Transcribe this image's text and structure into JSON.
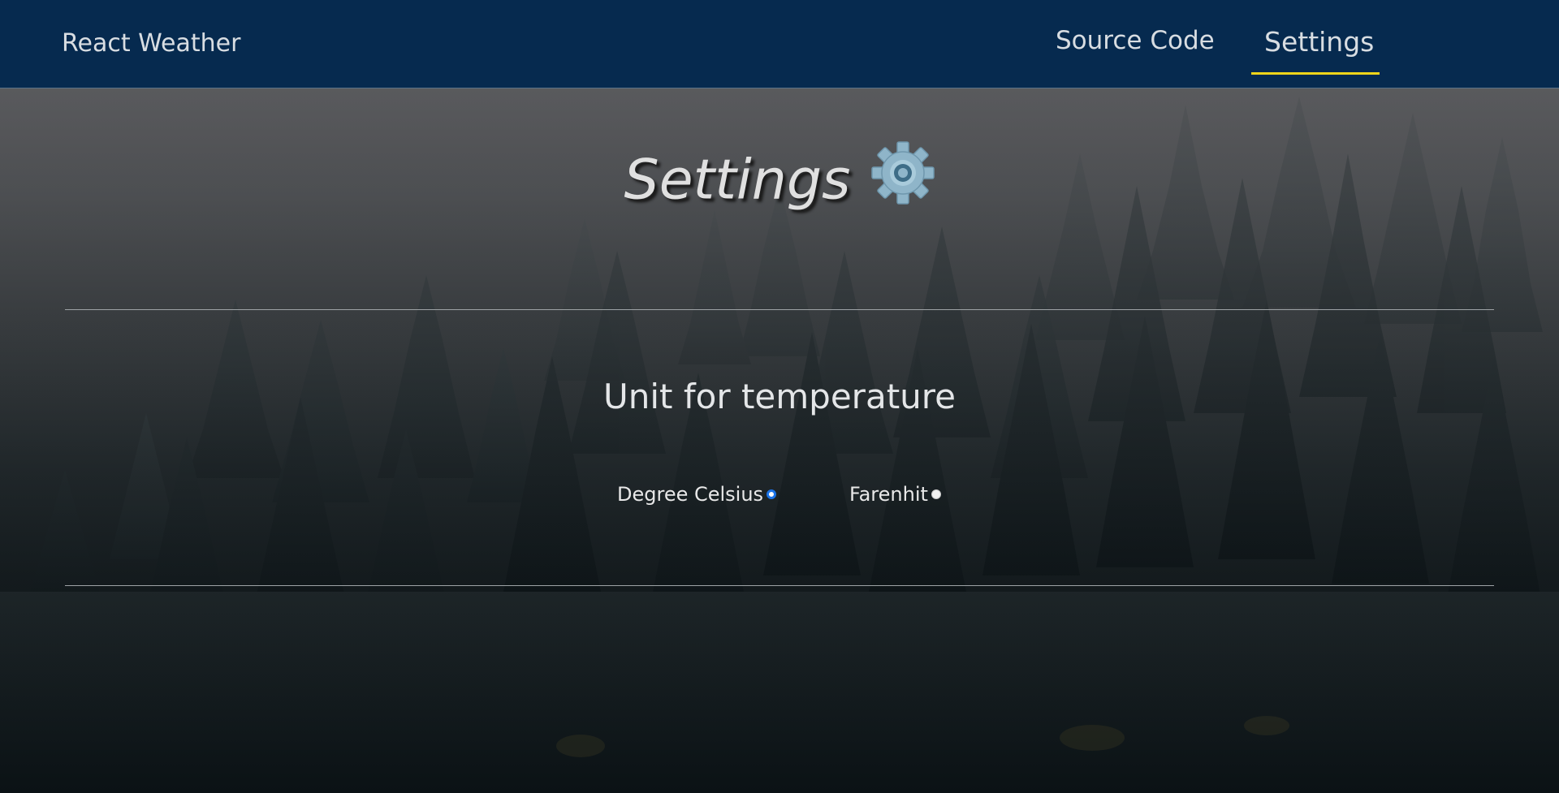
{
  "navbar": {
    "brand": "React Weather",
    "links": [
      {
        "label": "Source Code"
      },
      {
        "label": "Settings",
        "active": true
      }
    ],
    "active_underline_color": "#f2d51a",
    "background_color": "#062a4f"
  },
  "main": {
    "title": "Settings",
    "title_icon": "gear-icon",
    "section": {
      "heading": "Unit for temperature",
      "options": [
        {
          "label": "Degree Celsius",
          "checked": true
        },
        {
          "label": "Farenhit",
          "checked": false
        }
      ]
    }
  },
  "background": {
    "description_icon": "foggy-forest-background"
  }
}
